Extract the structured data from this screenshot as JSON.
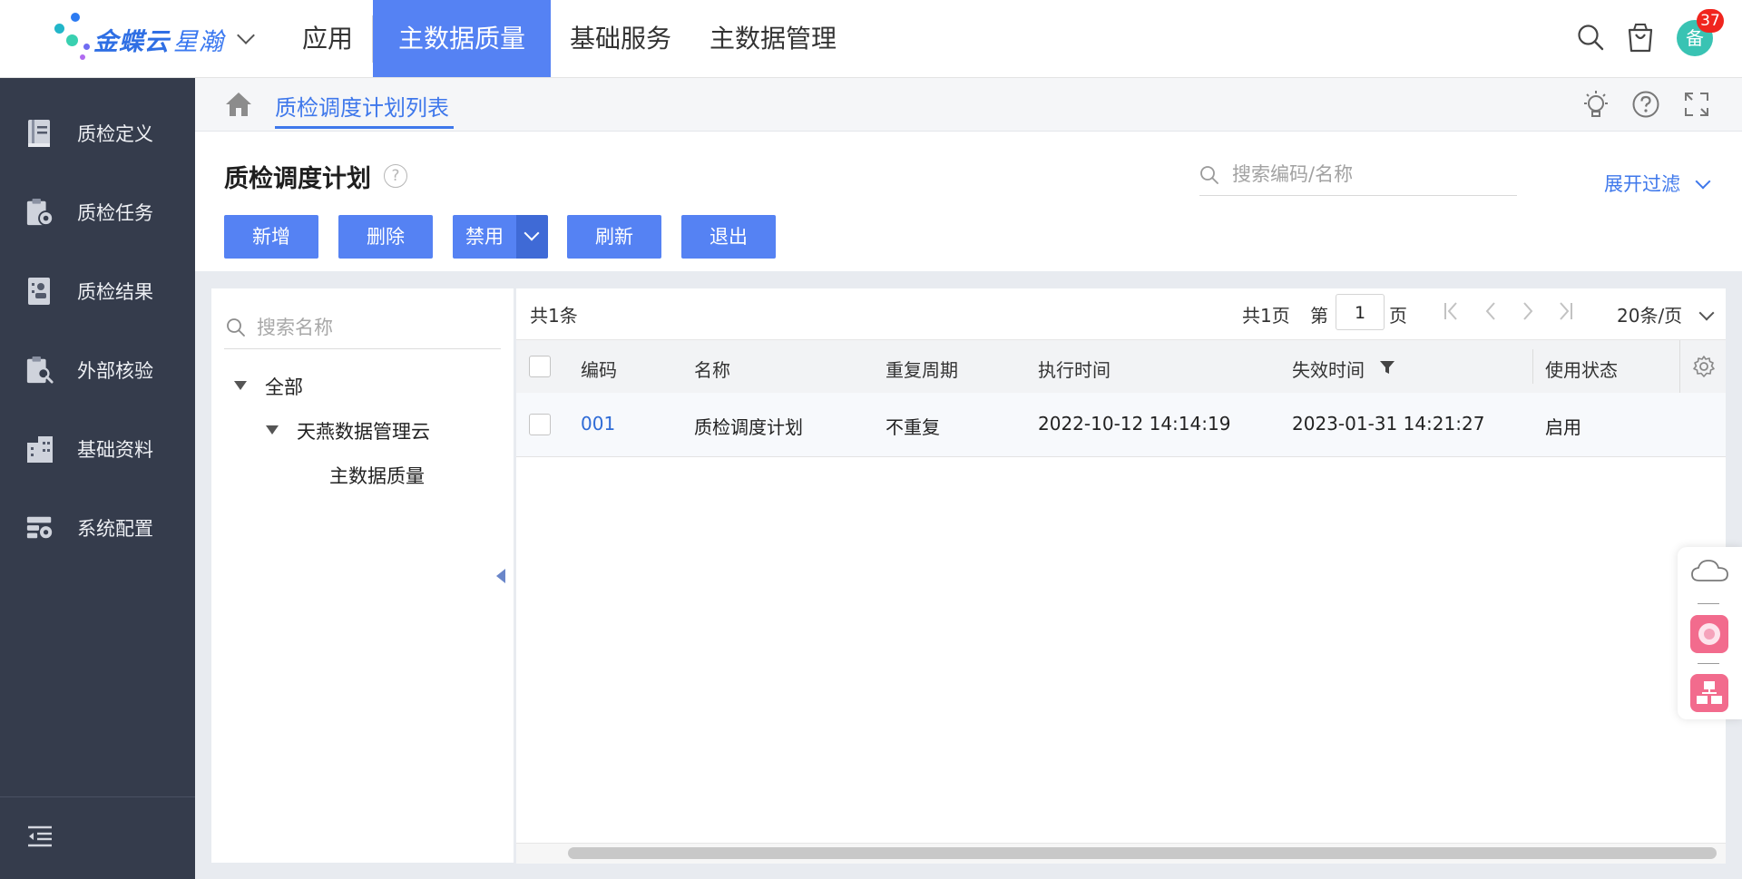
{
  "topbar": {
    "brand_name": "金蝶云",
    "brand_sub": "星瀚",
    "nav": [
      {
        "label": "应用",
        "active": false
      },
      {
        "label": "主数据质量",
        "active": true
      },
      {
        "label": "基础服务",
        "active": false
      },
      {
        "label": "主数据管理",
        "active": false
      }
    ],
    "avatar_text": "备",
    "notification_count": "37",
    "icons": [
      "search-icon",
      "shopping-bag-icon"
    ]
  },
  "sidebar": {
    "items": [
      {
        "label": "质检定义",
        "icon": "book-icon"
      },
      {
        "label": "质检任务",
        "icon": "clipboard-gear-icon"
      },
      {
        "label": "质检结果",
        "icon": "report-icon"
      },
      {
        "label": "外部核验",
        "icon": "clipboard-search-icon"
      },
      {
        "label": "基础资料",
        "icon": "building-icon"
      },
      {
        "label": "系统配置",
        "icon": "settings-panel-icon"
      }
    ],
    "collapse_icon": "collapse-menu-icon"
  },
  "breadcrumb": {
    "tab_label": "质检调度计划列表",
    "icons": [
      "home-icon",
      "lightbulb-icon",
      "help-icon",
      "fullscreen-icon"
    ]
  },
  "header": {
    "title": "质检调度计划",
    "search_placeholder": "搜索编码/名称",
    "expand_filter": "展开过滤",
    "buttons": {
      "add": "新增",
      "delete": "删除",
      "disable": "禁用",
      "refresh": "刷新",
      "exit": "退出"
    }
  },
  "tree": {
    "search_placeholder": "搜索名称",
    "nodes": [
      {
        "label": "全部",
        "level": 0
      },
      {
        "label": "天燕数据管理云",
        "level": 1
      },
      {
        "label": "主数据质量",
        "level": 2
      }
    ]
  },
  "grid": {
    "total": "共1条",
    "pager": {
      "pages": "共1页",
      "page_prefix": "第",
      "page_value": "1",
      "page_suffix": "页",
      "page_size": "20条/页"
    },
    "columns": [
      "编码",
      "名称",
      "重复周期",
      "执行时间",
      "失效时间",
      "使用状态"
    ],
    "rows": [
      {
        "code": "001",
        "name": "质检调度计划",
        "repeat": "不重复",
        "exec_time": "2022-10-12 14:14:19",
        "expire_time": "2023-01-31 14:21:27",
        "status": "启用"
      }
    ]
  },
  "colors": {
    "primary": "#5582f3",
    "primary_dark": "#3f6ad6",
    "link": "#3f78eb",
    "sidebar_bg": "#353c4c",
    "badge": "#f0251e",
    "avatar": "#39c3b3"
  }
}
